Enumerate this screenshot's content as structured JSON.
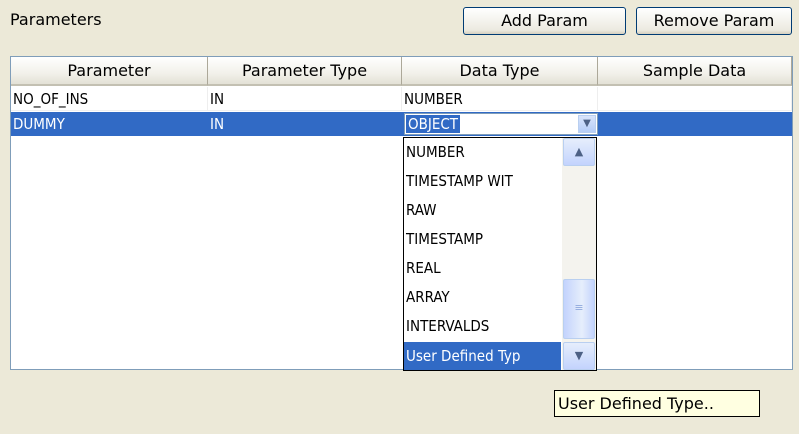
{
  "panel": {
    "title": "Parameters",
    "add_label": "Add Param",
    "remove_label": "Remove Param"
  },
  "table": {
    "columns": [
      "Parameter",
      "Parameter Type",
      "Data Type",
      "Sample Data"
    ],
    "rows": [
      {
        "parameter": "NO_OF_INS",
        "param_type": "IN",
        "data_type": "NUMBER",
        "sample": ""
      },
      {
        "parameter": "DUMMY",
        "param_type": "IN",
        "data_type": "OBJECT",
        "sample": ""
      }
    ]
  },
  "dropdown": {
    "options": [
      "NUMBER",
      "TIMESTAMP WIT",
      "RAW",
      "TIMESTAMP",
      "REAL",
      "ARRAY",
      "INTERVALDS",
      "User Defined Typ"
    ],
    "selected_index": 7,
    "scroll_up_icon": "chevron-up-icon",
    "scroll_down_icon": "chevron-down-icon"
  },
  "tooltip": {
    "text": "User Defined Type.."
  },
  "colors": {
    "selection": "#316AC5",
    "window_bg": "#ECE9D8",
    "tooltip_bg": "#FFFFE1"
  }
}
